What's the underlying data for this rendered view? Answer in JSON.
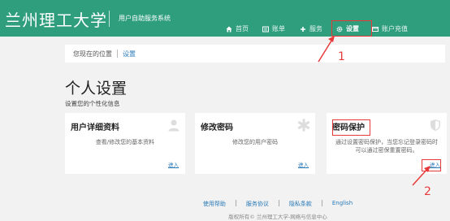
{
  "header": {
    "logo": "兰州理工大学",
    "subtitle": "用户自助服务系统",
    "nav": [
      {
        "label": "首页",
        "icon": "home-icon"
      },
      {
        "label": "账单",
        "icon": "bill-icon"
      },
      {
        "label": "服务",
        "icon": "service-icon"
      },
      {
        "label": "设置",
        "icon": "gear-icon"
      },
      {
        "label": "账户充值",
        "icon": "card-icon"
      }
    ]
  },
  "breadcrumb": {
    "prefix": "您现在的位置",
    "current": "设置"
  },
  "page": {
    "title": "个人设置",
    "description": "设置您的个性化信息"
  },
  "cards": [
    {
      "title": "用户详细资料",
      "description": "查看/修改您的基本资料",
      "link": "进入",
      "icon": "user-icon"
    },
    {
      "title": "修改密码",
      "description": "修改您的用户密码",
      "link": "进入",
      "icon": "asterisk-icon"
    },
    {
      "title": "密码保护",
      "description": "通过设置密码保护，当您忘记登录密码时可以通过密保重置密码。",
      "link": "进入",
      "icon": "shield-icon"
    }
  ],
  "footer": {
    "links": [
      "使用帮助",
      "服务协议",
      "隐私条款",
      "English"
    ],
    "copyright": "版权所有© 兰州理工大学-网络与信息中心"
  },
  "annotations": {
    "marker1": "1",
    "marker2": "2",
    "color": "#e83a3a"
  },
  "colors": {
    "header": "#2e9e7c",
    "link": "#2a7ab8"
  }
}
